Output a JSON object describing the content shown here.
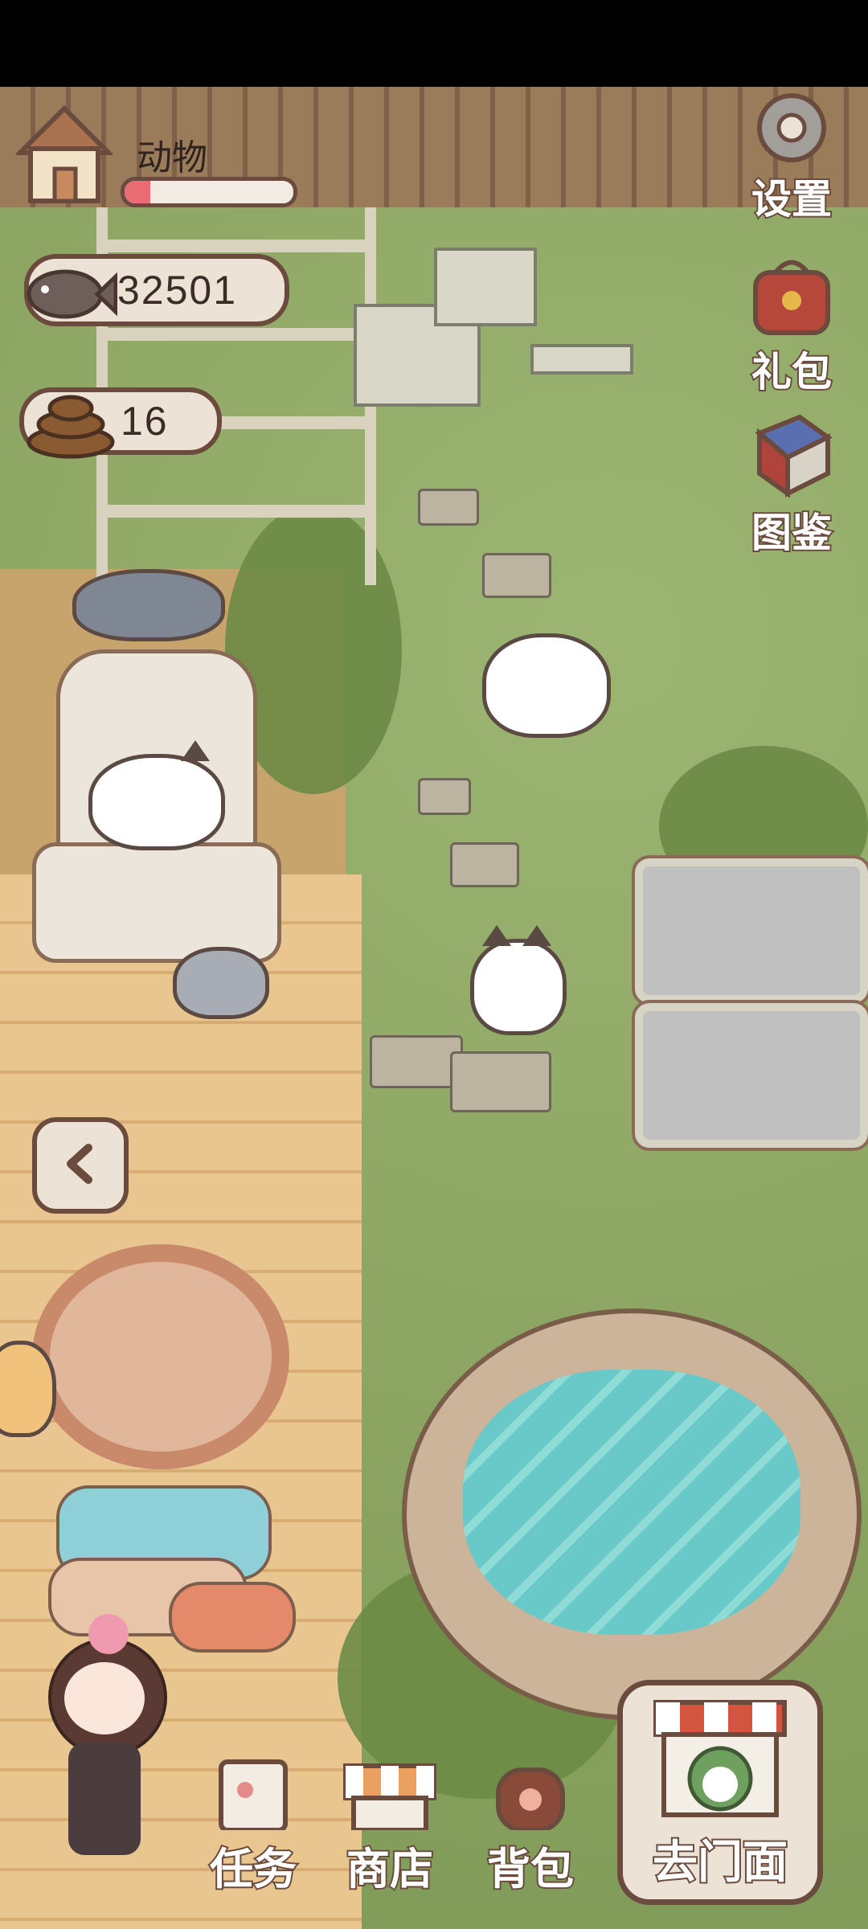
{
  "hud": {
    "animal_label": "动物",
    "animal_progress": 0.15,
    "fish_count": "32501",
    "poop_count": "16"
  },
  "side_menu": {
    "settings": "设置",
    "gift": "礼包",
    "collection": "图鉴"
  },
  "bottom_menu": {
    "tasks": "任务",
    "shop": "商店",
    "backpack": "背包",
    "storefront": "去门面"
  },
  "colors": {
    "outline": "#6b4b3e",
    "panel": "#ece3d6",
    "progress_fill": "#e96b73",
    "grass": "#8fa765",
    "deck": "#e9c58f",
    "water": "#69c8c8"
  },
  "icons": {
    "home": "house-icon",
    "fish": "fish-icon",
    "poop": "poop-icon",
    "settings": "gear-icon",
    "gift": "gift-bag-icon",
    "collection": "book-icon",
    "back": "chevron-left-icon",
    "tasks": "clipboard-icon",
    "shop": "market-stall-icon",
    "backpack": "backpack-icon",
    "storefront": "storefront-icon"
  }
}
